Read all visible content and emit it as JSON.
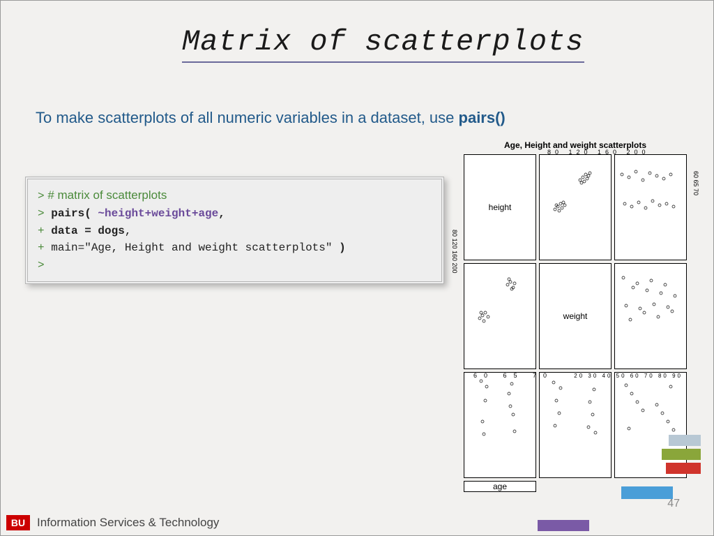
{
  "title": "Matrix of scatterplots",
  "subtitle_pre": "To make scatterplots of all numeric variables in a dataset, use ",
  "subtitle_bold": "pairs()",
  "code": {
    "l1_prompt": ">",
    "l1_comment": " # matrix of scatterplots",
    "l2_prompt": ">",
    "l2_func": "pairs(",
    "l2_formula": " ~height+weight+age",
    "l2_comma": ",",
    "l3_prompt": "+",
    "l3_data": "data = dogs",
    "l3_comma": ",",
    "l4_prompt": "+",
    "l4_args": " main=\"Age, Height and weight scatterplots\" ",
    "l4_close": ")",
    "l5_prompt": ">"
  },
  "chart": {
    "title": "Age, Height and weight scatterplots",
    "vars": [
      "height",
      "weight",
      "age"
    ],
    "ticks_top": "80   120   160   200",
    "ticks_left": "80  120  160  200",
    "ticks_right": "60  65  70",
    "ticks_bottom1": "60  65  70",
    "ticks_bottom3": "20 30 40 50 60 70 80 90"
  },
  "footer": {
    "org": "BU",
    "dept": "Information Services & Technology",
    "page": "47"
  }
}
